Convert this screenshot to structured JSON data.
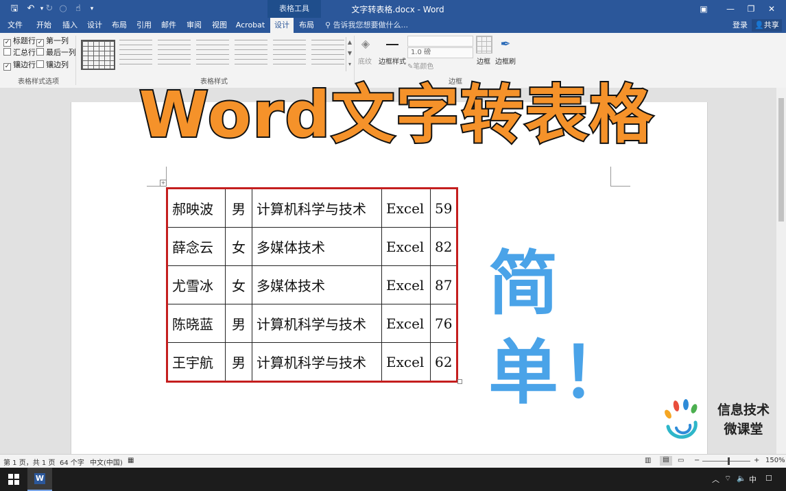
{
  "titlebar": {
    "title": "文字转表格.docx - Word",
    "context_tab": "表格工具",
    "qat": {
      "save": "🖫",
      "undo": "↶",
      "redo": "↻",
      "touch": "☝",
      "custom": "▾"
    },
    "window": {
      "ribbon_opts": "▣",
      "minimize": "—",
      "restore": "❐",
      "close": "✕"
    }
  },
  "tabs": {
    "items": [
      "文件",
      "开始",
      "插入",
      "设计",
      "布局",
      "引用",
      "邮件",
      "审阅",
      "视图",
      "Acrobat",
      "设计",
      "布局"
    ],
    "active_index": 10,
    "tell_me": "告诉我您想要做什么...",
    "login": "登录",
    "share": "共享"
  },
  "ribbon": {
    "style_options": {
      "header_row": "标题行",
      "total_row": "汇总行",
      "banded_rows": "镶边行",
      "first_column": "第一列",
      "last_column": "最后一列",
      "banded_columns": "镶边列",
      "label": "表格样式选项"
    },
    "table_styles_label": "表格样式",
    "shading": "底纹",
    "border_styles": "边框样式",
    "weight": "1.0 磅",
    "pen_color": "笔颜色",
    "borders": "边框",
    "border_painter": "边框刷",
    "borders_group": "边框"
  },
  "overlay": {
    "headline": "Word文字转表格",
    "simple": "简单！",
    "logo_line1": "信息技术",
    "logo_line2": "微课堂"
  },
  "table": {
    "rows": [
      [
        "郝映波",
        "男",
        "计算机科学与技术",
        "Excel",
        "59"
      ],
      [
        "薛念云",
        "女",
        "多媒体技术",
        "Excel",
        "82"
      ],
      [
        "尤雪冰",
        "女",
        "多媒体技术",
        "Excel",
        "87"
      ],
      [
        "陈晓蓝",
        "男",
        "计算机科学与技术",
        "Excel",
        "76"
      ],
      [
        "王宇航",
        "男",
        "计算机科学与技术",
        "Excel",
        "62"
      ]
    ]
  },
  "status": {
    "page": "第 1 页，共 1 页",
    "words": "64 个字",
    "language": "中文(中国)",
    "zoom": "150%",
    "zoom_minus": "−",
    "zoom_plus": "+"
  },
  "taskbar": {
    "tray_up": "︿",
    "ime": "中"
  },
  "colors": {
    "title_blue": "#2b579a",
    "headline_orange": "#f5922a",
    "simple_blue": "#4aa3e8",
    "table_border_red": "#c41e1e"
  }
}
